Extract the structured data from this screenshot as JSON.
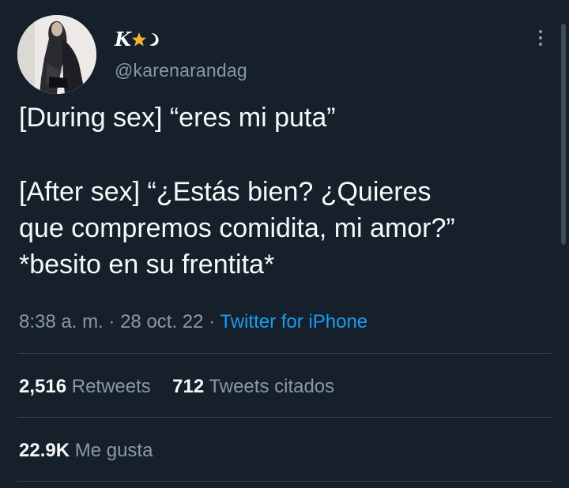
{
  "author": {
    "display_name": "K",
    "handle": "@karenarandag"
  },
  "tweet": {
    "lines": [
      "[During sex] “eres mi puta”",
      "[After sex] “¿Estás bien? ¿Quieres",
      "que compremos comidita, mi amor?”",
      "*besito en su frentita*"
    ],
    "time": "8:38 a. m.",
    "separator": "·",
    "date": "28 oct. 22",
    "source": "Twitter for iPhone"
  },
  "stats": {
    "retweets_count": "2,516",
    "retweets_label": "Retweets",
    "quotes_count": "712",
    "quotes_label": "Tweets citados",
    "likes_count": "22.9K",
    "likes_label": "Me gusta"
  },
  "icons": {
    "more": "more-options-icon",
    "star": "star-icon",
    "moon": "crescent-moon-icon"
  },
  "colors": {
    "background": "#15202b",
    "text": "#f7f9f9",
    "secondary": "#8b98a5",
    "link": "#1d9bf0",
    "star": "#f5b335",
    "divider": "#38444d"
  }
}
